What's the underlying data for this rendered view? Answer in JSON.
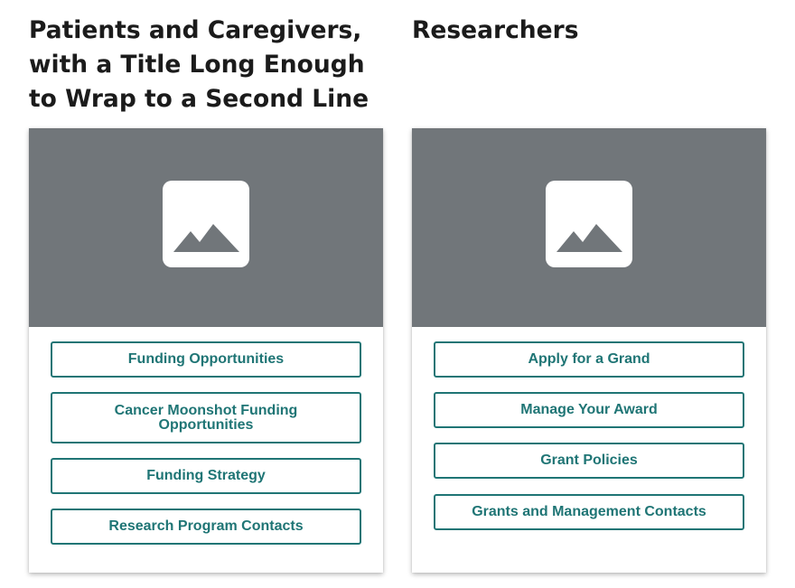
{
  "columns": [
    {
      "title": "Patients and Caregivers, with a Title Long Enough to Wrap to a Second Line",
      "links": [
        "Funding Opportunities",
        "Cancer Moonshot Funding Opportunities",
        "Funding Strategy",
        "Research Program Contacts"
      ]
    },
    {
      "title": "Researchers",
      "links": [
        "Apply for a Grand",
        "Manage Your Award",
        "Grant Policies",
        "Grants and Management Contacts"
      ]
    }
  ],
  "icons": {
    "card_image": "image-placeholder-icon"
  },
  "colors": {
    "image_background": "#71767a",
    "link_accent": "#1f7575",
    "title_text": "#1b1b1b"
  }
}
